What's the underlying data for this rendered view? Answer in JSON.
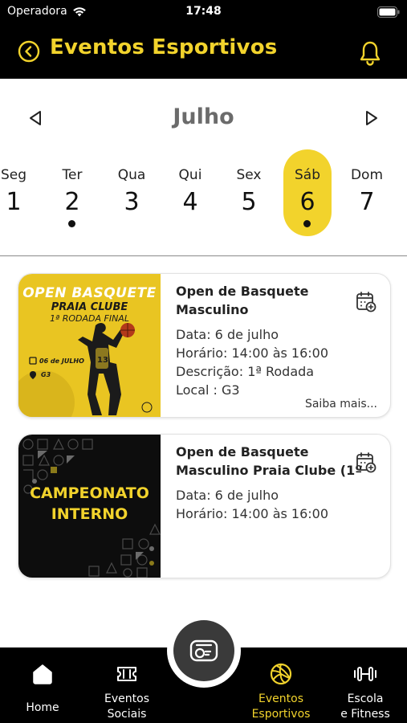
{
  "status_bar": {
    "carrier": "Operadora",
    "time": "17:48"
  },
  "header": {
    "title": "Eventos Esportivos"
  },
  "calendar": {
    "month": "Julho",
    "days": [
      {
        "name": "Seg",
        "num": "1",
        "has_event": false,
        "selected": false
      },
      {
        "name": "Ter",
        "num": "2",
        "has_event": true,
        "selected": false
      },
      {
        "name": "Qua",
        "num": "3",
        "has_event": false,
        "selected": false
      },
      {
        "name": "Qui",
        "num": "4",
        "has_event": false,
        "selected": false
      },
      {
        "name": "Sex",
        "num": "5",
        "has_event": false,
        "selected": false
      },
      {
        "name": "Sáb",
        "num": "6",
        "has_event": true,
        "selected": true
      },
      {
        "name": "Dom",
        "num": "7",
        "has_event": false,
        "selected": false
      }
    ]
  },
  "events": [
    {
      "title_line1": "Open de Basquete",
      "title_line2": "Masculino",
      "date": "Data: 6 de julho",
      "time": "Horário: 14:00 às 16:00",
      "description": "Descrição: 1ª Rodada",
      "location": "Local : G3",
      "more": "Saiba mais...",
      "thumb": {
        "title": "OPEN BASQUETE",
        "subtitle": "PRAIA CLUBE",
        "round": "1ª RODADA FINAL",
        "date": "06 de JULHO",
        "location": "G3"
      }
    },
    {
      "title_line1": "Open de Basquete",
      "title_line2": "Masculino Praia Clube (1º",
      "date": "Data: 6 de julho",
      "time": "Horário: 14:00 às 16:00",
      "thumb": {
        "line1": "CAMPEONATO",
        "line2": "INTERNO"
      }
    }
  ],
  "tabbar": {
    "items": [
      {
        "label_line1": "Home",
        "label_line2": "",
        "icon": "home-icon",
        "active": false
      },
      {
        "label_line1": "Eventos",
        "label_line2": "Sociais",
        "icon": "ticket-icon",
        "active": false
      },
      {
        "label_line1": "Eventos",
        "label_line2": "Esportivos",
        "icon": "volleyball-icon",
        "active": true
      },
      {
        "label_line1": "Escola",
        "label_line2": "e Fitness",
        "icon": "dumbbell-icon",
        "active": false
      }
    ],
    "center_icon": "card-reader-icon"
  },
  "colors": {
    "accent": "#F2D32C",
    "bar": "#000000"
  }
}
